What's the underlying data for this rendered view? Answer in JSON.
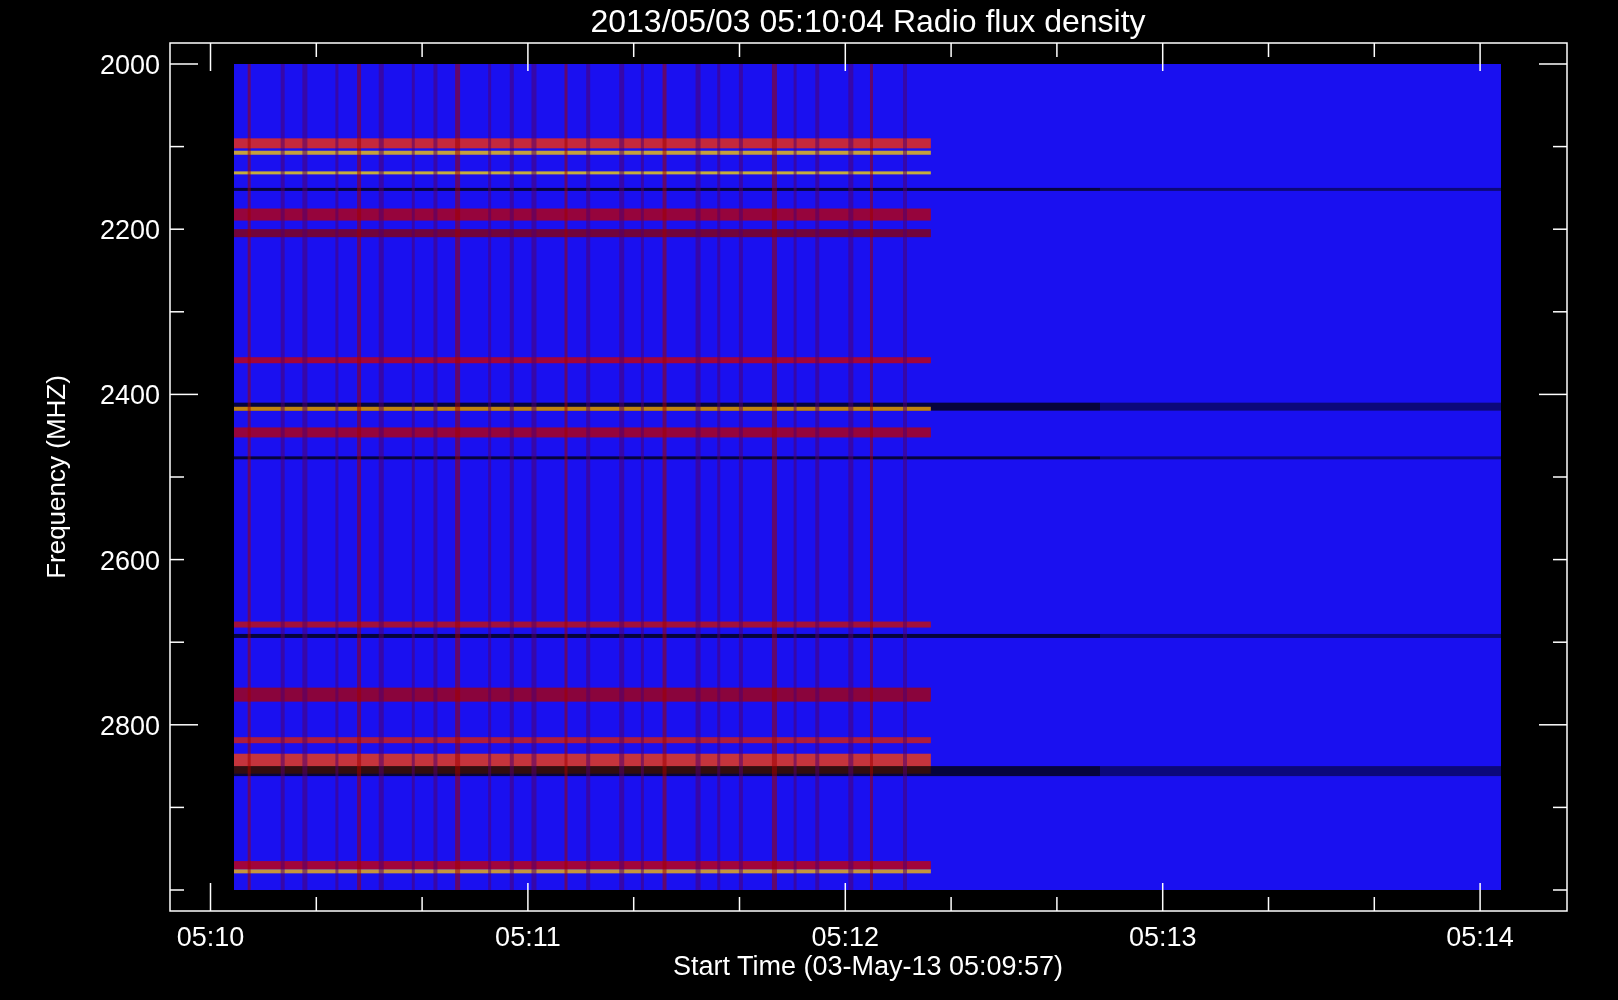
{
  "title": "2013/05/03 05:10:04 Radio flux density",
  "y_axis": {
    "label": "Frequency (MHZ)",
    "ticks": [
      "2000",
      "2200",
      "2400",
      "2600",
      "2800"
    ]
  },
  "x_axis": {
    "label": "Start Time (03-May-13 05:09:57)",
    "ticks": [
      "05:10",
      "05:11",
      "05:12",
      "05:13",
      "05:14"
    ]
  }
}
